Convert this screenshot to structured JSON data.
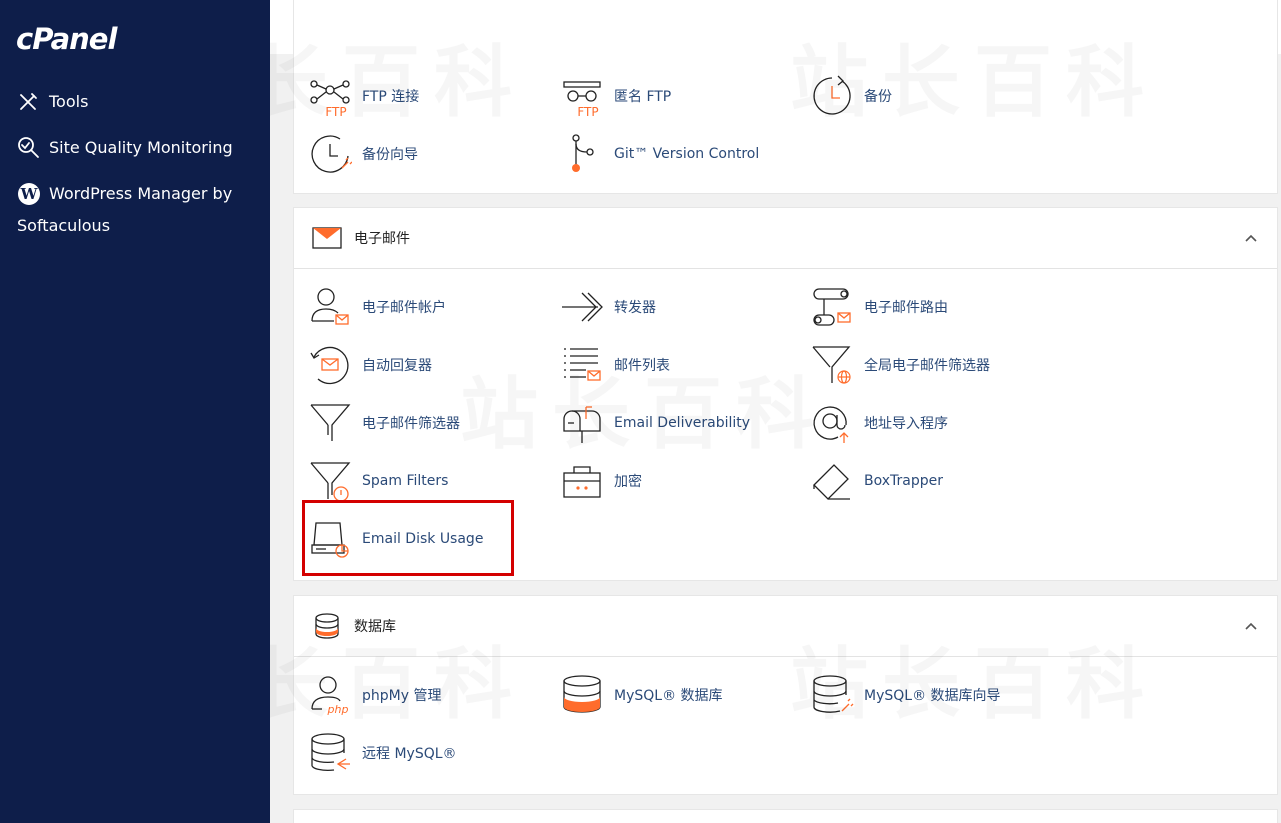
{
  "app": {
    "logo_text": "cPanel"
  },
  "sidebar": {
    "items": [
      {
        "label": "Tools",
        "icon": "tools-icon"
      },
      {
        "label": "Site Quality Monitoring",
        "icon": "magnifier-icon"
      },
      {
        "label": "WordPress Manager by",
        "label_line2": "Softaculous",
        "icon": "wordpress-icon"
      }
    ]
  },
  "files_section": {
    "items": [
      {
        "label": "FTP 连接",
        "icon": "ftp-connections-icon"
      },
      {
        "label": "匿名 FTP",
        "icon": "anonymous-ftp-icon"
      },
      {
        "label": "备份",
        "icon": "backup-icon"
      },
      {
        "label": "备份向导",
        "icon": "backup-wizard-icon"
      },
      {
        "label": "Git™ Version Control",
        "icon": "git-icon"
      }
    ]
  },
  "email_section": {
    "title": "电子邮件",
    "items": [
      {
        "label": "电子邮件帐户",
        "icon": "email-accounts-icon"
      },
      {
        "label": "转发器",
        "icon": "forwarders-icon"
      },
      {
        "label": "电子邮件路由",
        "icon": "email-routing-icon"
      },
      {
        "label": "自动回复器",
        "icon": "autoresponders-icon"
      },
      {
        "label": "邮件列表",
        "icon": "mailing-lists-icon"
      },
      {
        "label": "全局电子邮件筛选器",
        "icon": "global-filters-icon"
      },
      {
        "label": "电子邮件筛选器",
        "icon": "email-filters-icon"
      },
      {
        "label": "Email Deliverability",
        "icon": "mailbox-icon"
      },
      {
        "label": "地址导入程序",
        "icon": "address-importer-icon"
      },
      {
        "label": "Spam Filters",
        "icon": "spam-filters-icon"
      },
      {
        "label": "加密",
        "icon": "encryption-icon"
      },
      {
        "label": "BoxTrapper",
        "icon": "boxtrapper-icon"
      },
      {
        "label": "Email Disk Usage",
        "icon": "email-disk-usage-icon"
      }
    ]
  },
  "database_section": {
    "title": "数据库",
    "items": [
      {
        "label": "phpMy 管理",
        "icon": "phpmyadmin-icon"
      },
      {
        "label": "MySQL® 数据库",
        "icon": "mysql-databases-icon"
      },
      {
        "label": "MySQL® 数据库向导",
        "icon": "mysql-wizard-icon"
      },
      {
        "label": "远程 MySQL®",
        "icon": "remote-mysql-icon"
      }
    ]
  },
  "watermark_text": "站长百科",
  "colors": {
    "sidebar": "#0e1e4a",
    "accent": "#ff6c2c",
    "link": "#2b4a78",
    "highlight": "#d40000"
  }
}
